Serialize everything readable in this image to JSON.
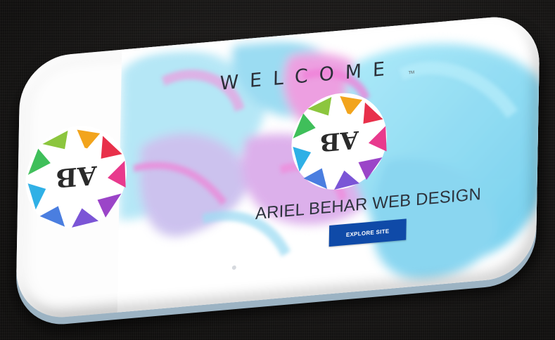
{
  "hero": {
    "welcome_text": "WELCOME",
    "trademark": "TM",
    "brand_name": "ARIEL BEHAR WEB DESIGN",
    "explore_label": "EXPLORE SITE",
    "logo_monogram": "AB"
  },
  "colors": {
    "button_blue": "#0f4aa8",
    "ink_cyan": "#7fd8f2",
    "ink_magenta": "#e77bd9",
    "background": "#1b1a19"
  },
  "icons": {
    "logo": "ab-monogram-logo",
    "scroll": "scroll-dot"
  }
}
